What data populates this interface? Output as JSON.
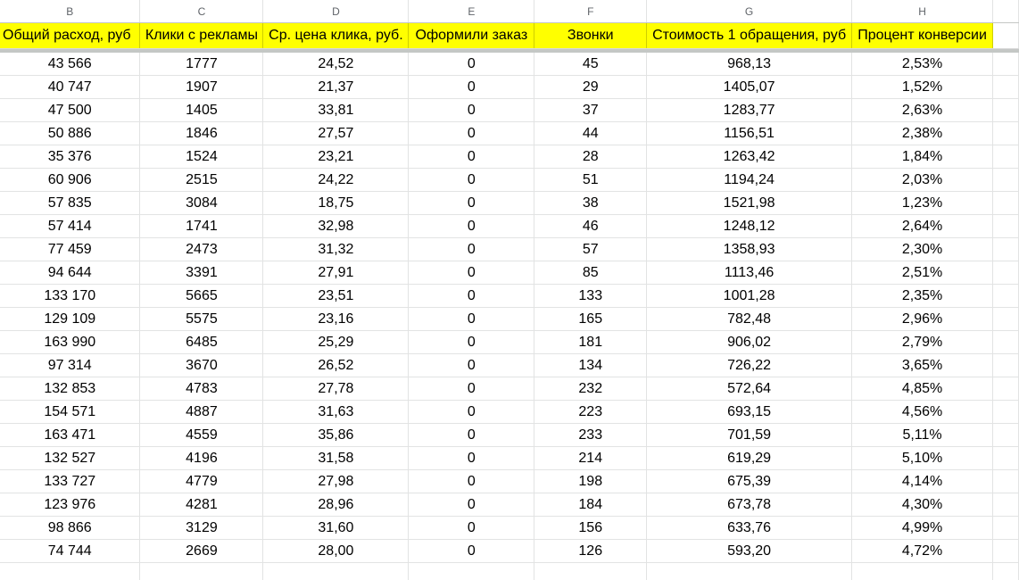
{
  "columns": [
    "B",
    "C",
    "D",
    "E",
    "F",
    "G",
    "H",
    ""
  ],
  "headers": [
    "Общий расход, руб",
    "Клики с рекламы",
    "Ср. цена клика, руб.",
    "Оформили заказ",
    "Звонки",
    "Стоимость 1 обращения, руб",
    "Процент конверсии"
  ],
  "rows": [
    [
      "43 566",
      "1777",
      "24,52",
      "0",
      "45",
      "968,13",
      "2,53%"
    ],
    [
      "40 747",
      "1907",
      "21,37",
      "0",
      "29",
      "1405,07",
      "1,52%"
    ],
    [
      "47 500",
      "1405",
      "33,81",
      "0",
      "37",
      "1283,77",
      "2,63%"
    ],
    [
      "50 886",
      "1846",
      "27,57",
      "0",
      "44",
      "1156,51",
      "2,38%"
    ],
    [
      "35 376",
      "1524",
      "23,21",
      "0",
      "28",
      "1263,42",
      "1,84%"
    ],
    [
      "60 906",
      "2515",
      "24,22",
      "0",
      "51",
      "1194,24",
      "2,03%"
    ],
    [
      "57 835",
      "3084",
      "18,75",
      "0",
      "38",
      "1521,98",
      "1,23%"
    ],
    [
      "57 414",
      "1741",
      "32,98",
      "0",
      "46",
      "1248,12",
      "2,64%"
    ],
    [
      "77 459",
      "2473",
      "31,32",
      "0",
      "57",
      "1358,93",
      "2,30%"
    ],
    [
      "94 644",
      "3391",
      "27,91",
      "0",
      "85",
      "1113,46",
      "2,51%"
    ],
    [
      "133 170",
      "5665",
      "23,51",
      "0",
      "133",
      "1001,28",
      "2,35%"
    ],
    [
      "129 109",
      "5575",
      "23,16",
      "0",
      "165",
      "782,48",
      "2,96%"
    ],
    [
      "163 990",
      "6485",
      "25,29",
      "0",
      "181",
      "906,02",
      "2,79%"
    ],
    [
      "97 314",
      "3670",
      "26,52",
      "0",
      "134",
      "726,22",
      "3,65%"
    ],
    [
      "132 853",
      "4783",
      "27,78",
      "0",
      "232",
      "572,64",
      "4,85%"
    ],
    [
      "154 571",
      "4887",
      "31,63",
      "0",
      "223",
      "693,15",
      "4,56%"
    ],
    [
      "163 471",
      "4559",
      "35,86",
      "0",
      "233",
      "701,59",
      "5,11%"
    ],
    [
      "132 527",
      "4196",
      "31,58",
      "0",
      "214",
      "619,29",
      "5,10%"
    ],
    [
      "133 727",
      "4779",
      "27,98",
      "0",
      "198",
      "675,39",
      "4,14%"
    ],
    [
      "123 976",
      "4281",
      "28,96",
      "0",
      "184",
      "673,78",
      "4,30%"
    ],
    [
      "98 866",
      "3129",
      "31,60",
      "0",
      "156",
      "633,76",
      "4,99%"
    ],
    [
      "74 744",
      "2669",
      "28,00",
      "0",
      "126",
      "593,20",
      "4,72%"
    ]
  ],
  "colors": {
    "header_fill": "#ffff00",
    "gridline": "#e2e3e3",
    "freeze_bar": "#c4c7c5",
    "column_letter": "#5f6368"
  }
}
